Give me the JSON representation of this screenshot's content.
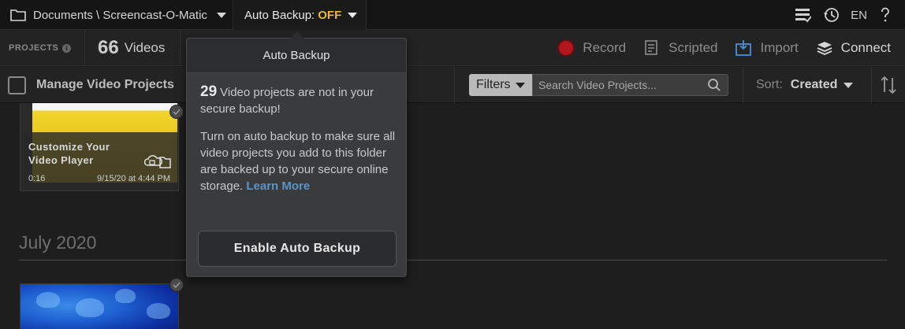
{
  "topbar": {
    "path": "Documents \\ Screencast-O-Matic",
    "auto_backup_label": "Auto Backup:",
    "auto_backup_state": "OFF",
    "language": "EN",
    "icons": [
      "folder-icon",
      "tasks-icon",
      "history-icon",
      "help-icon"
    ]
  },
  "toolbar": {
    "projects_label": "PROJECTS",
    "video_count": "66",
    "videos_label": "Videos",
    "record_label": "Record",
    "scripted_label": "Scripted",
    "import_label": "Import",
    "connect_label": "Connect",
    "record_color": "#b3161b"
  },
  "filterbar": {
    "manage_label": "Manage Video Projects",
    "filters_label": "Filters",
    "search_placeholder": "Search Video Projects...",
    "sort_label": "Sort:",
    "sort_value": "Created"
  },
  "content": {
    "video1": {
      "title": "Customize Your Video Player",
      "duration": "0:16",
      "date": "9/15/20 at 4:44 PM"
    },
    "month_header": "July 2020"
  },
  "popup": {
    "title": "Auto Backup",
    "count": "29",
    "count_text": "Video projects are not in your secure backup!",
    "description": "Turn on auto backup to make sure all video projects you add to this folder are backed up to your secure online storage.",
    "learn_more": "Learn More",
    "button_label": "Enable Auto Backup",
    "off_color": "#e7b93a",
    "link_color": "#5a95c9"
  }
}
